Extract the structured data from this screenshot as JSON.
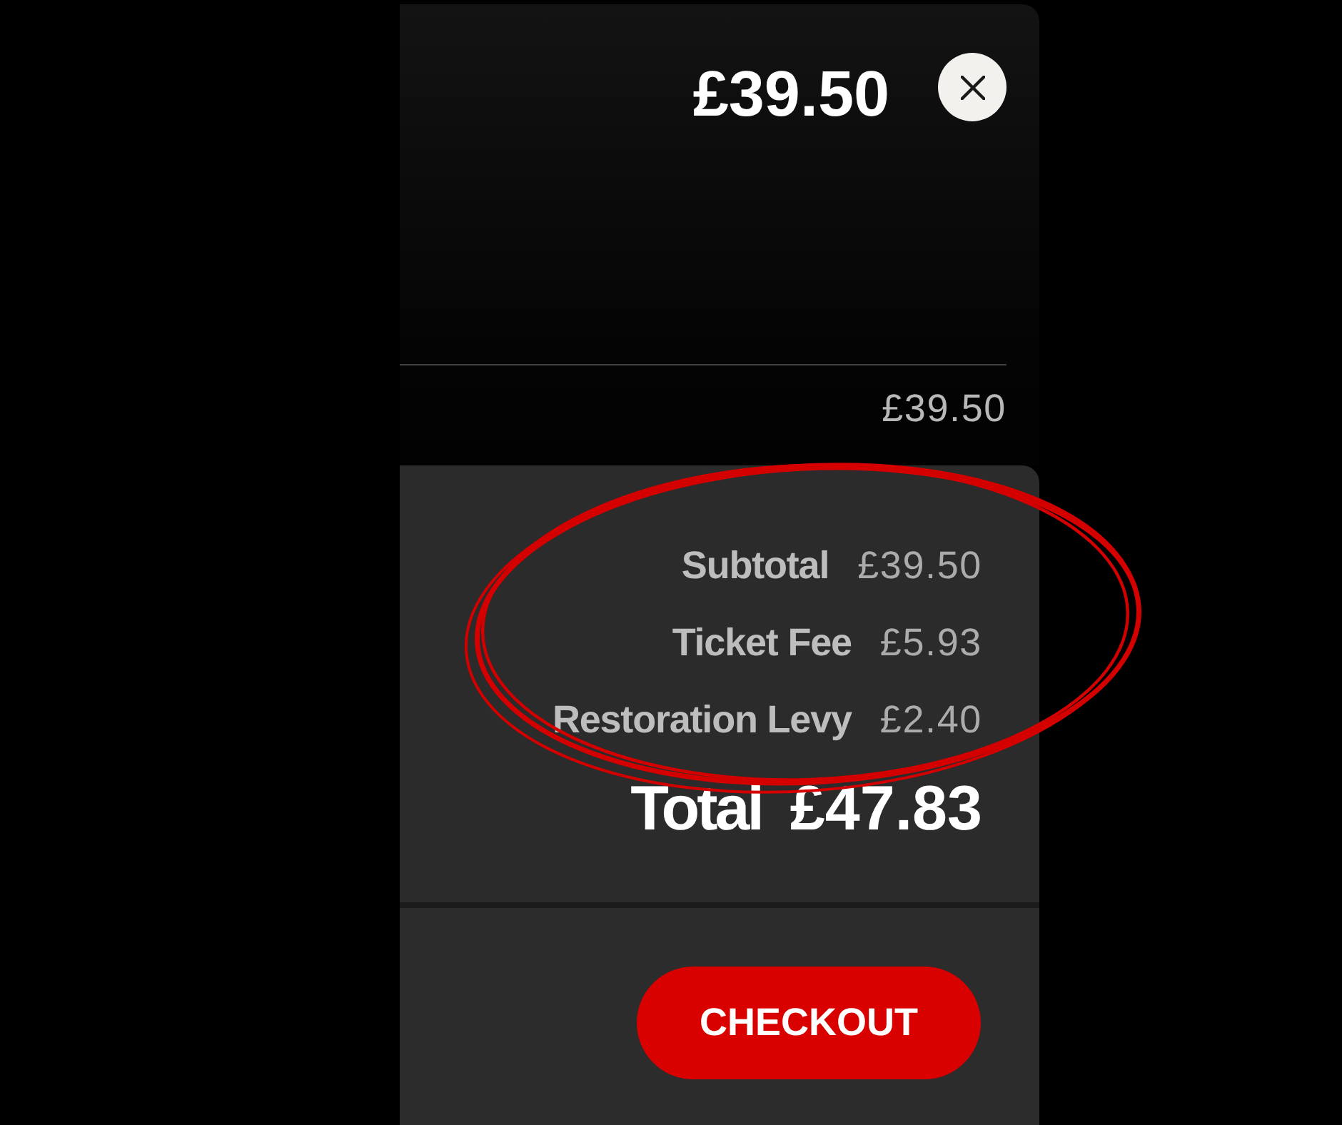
{
  "header": {
    "price": "£39.50"
  },
  "line_item": {
    "price": "£39.50"
  },
  "summary": {
    "rows": [
      {
        "label": "Subtotal",
        "value": "£39.50"
      },
      {
        "label": "Ticket Fee",
        "value": "£5.93"
      },
      {
        "label": "Restoration Levy",
        "value": "£2.40"
      }
    ],
    "total": {
      "label": "Total",
      "value": "£47.83"
    }
  },
  "checkout_button": {
    "label": "CHECKOUT"
  }
}
